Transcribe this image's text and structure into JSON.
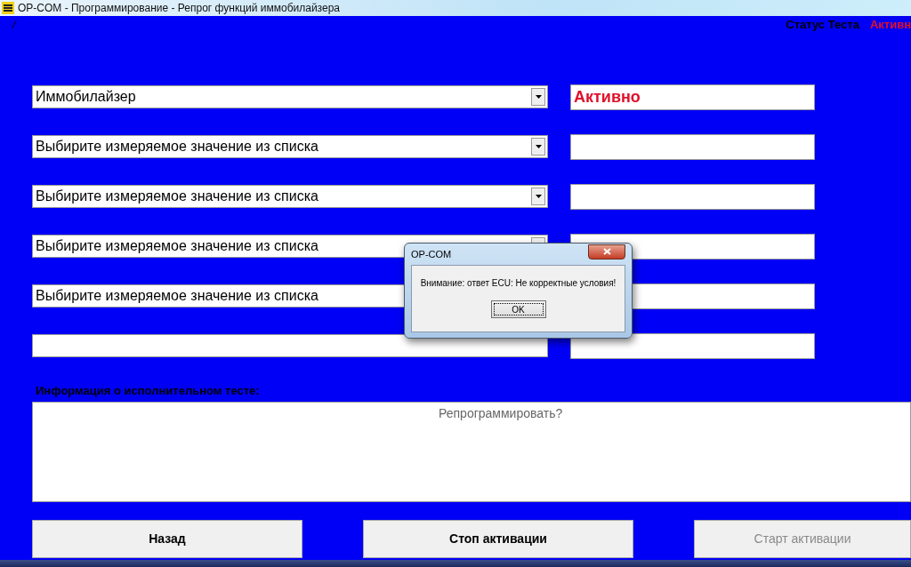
{
  "window": {
    "title": "OP-COM - Программирование - Репрог функций иммобилайзера"
  },
  "corner_mark": "/",
  "status": {
    "label": "Статус Теста",
    "value": "Активн"
  },
  "rows": [
    {
      "kind": "select",
      "value": "Иммобилайзер",
      "result": "Активно"
    },
    {
      "kind": "select",
      "value": "Выбирите измеряемое значение из списка"
    },
    {
      "kind": "select",
      "value": "Выбирите измеряемое значение из списка"
    },
    {
      "kind": "select",
      "value": "Выбирите измеряемое значение из списка"
    },
    {
      "kind": "field",
      "value": "Выбирите измеряемое значение из списка"
    },
    {
      "kind": "field"
    }
  ],
  "info": {
    "label": "Информация о исполнительном тесте:",
    "text": "Репрограммировать?"
  },
  "buttons": [
    {
      "label": "Назад",
      "disabled": false
    },
    {
      "label": "Стоп активации",
      "disabled": false
    },
    {
      "label": "Старт активации",
      "disabled": true
    }
  ],
  "dialog": {
    "title": "OP-COM",
    "message": "Внимание: ответ ECU: Не корректные условия!",
    "button": "OK"
  }
}
